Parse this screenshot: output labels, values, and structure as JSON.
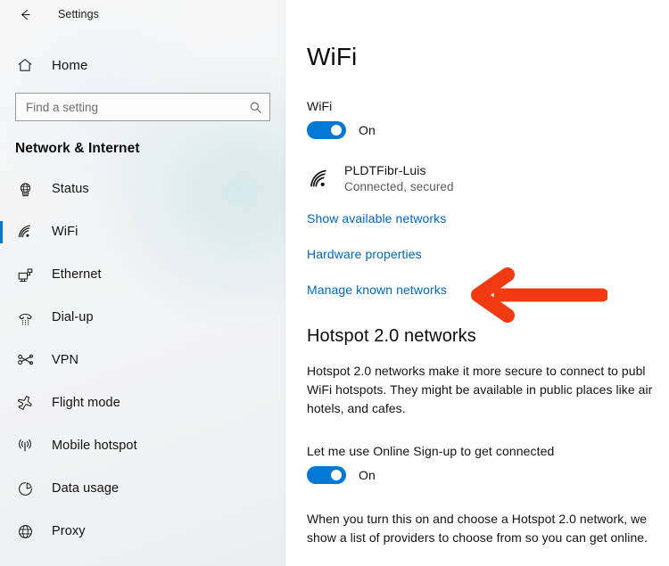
{
  "window": {
    "title": "Settings",
    "back_icon": "back-arrow-icon"
  },
  "sidebar": {
    "home": {
      "label": "Home",
      "icon": "home-icon"
    },
    "search": {
      "value": "",
      "placeholder": "Find a setting",
      "icon": "search-icon"
    },
    "category_title": "Network & Internet",
    "selected": "WiFi",
    "items": [
      {
        "label": "Status",
        "icon": "globe-monitor-icon",
        "selected": false
      },
      {
        "label": "WiFi",
        "icon": "wifi-icon",
        "selected": true
      },
      {
        "label": "Ethernet",
        "icon": "ethernet-icon",
        "selected": false
      },
      {
        "label": "Dial-up",
        "icon": "dialup-phone-icon",
        "selected": false
      },
      {
        "label": "VPN",
        "icon": "vpn-key-icon",
        "selected": false
      },
      {
        "label": "Flight mode",
        "icon": "airplane-icon",
        "selected": false
      },
      {
        "label": "Mobile hotspot",
        "icon": "hotspot-signal-icon",
        "selected": false
      },
      {
        "label": "Data usage",
        "icon": "pie-chart-icon",
        "selected": false
      },
      {
        "label": "Proxy",
        "icon": "globe-icon",
        "selected": false
      }
    ]
  },
  "main": {
    "page_title": "WiFi",
    "wifi_toggle": {
      "label": "WiFi",
      "state": "On",
      "on": true
    },
    "connected_network": {
      "name": "PLDTFibr-Luis",
      "status": "Connected, secured",
      "icon": "wifi-signal-icon"
    },
    "links": [
      {
        "label": "Show available networks"
      },
      {
        "label": "Hardware properties"
      },
      {
        "label": "Manage known networks"
      }
    ],
    "hotspot_section": {
      "title": "Hotspot 2.0 networks",
      "description": "Hotspot 2.0 networks make it more secure to connect to publ\nWiFi hotspots. They might be available in public places like air\nhotels, and cafes.",
      "toggle": {
        "label": "Let me use Online Sign-up to get connected",
        "state": "On",
        "on": true
      },
      "footer_text": "When you turn this on and choose a Hotspot 2.0 network, we\nshow a list of providers to choose from so you can get online."
    }
  },
  "annotation": {
    "type": "red-arrow-left",
    "color": "#f23a12",
    "points_to": "Manage known networks"
  },
  "colors": {
    "accent": "#0078d4",
    "link": "#0066bf",
    "annotation_red": "#f23a12"
  }
}
